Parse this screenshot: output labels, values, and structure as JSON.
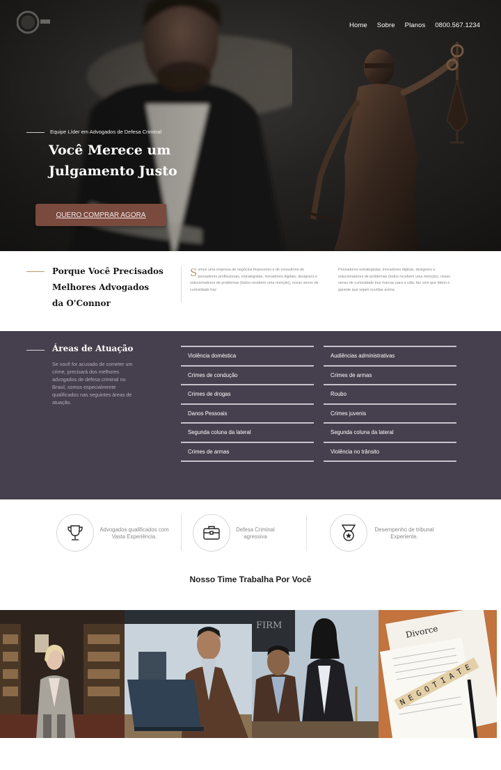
{
  "nav": {
    "items": [
      "Home",
      "Sobre",
      "Planos",
      "0800.567.1234"
    ]
  },
  "hero": {
    "eyebrow": "Equipe Líder em Advogados de Defesa Criminal",
    "title_line1": "Você Merece um",
    "title_line2": "Julgamento Justo",
    "cta": "QUERO COMPRAR AGORA"
  },
  "why": {
    "title_line1": "Porque Você Precisados",
    "title_line2": "Melhores Advogados",
    "title_line3": "da O'Connor",
    "dropcap": "S",
    "paragraph1": "omos uma empresa de negócios financeiros e de consultoria de pensadores profissionais, estrategistas, inovadores digitais, designers e solucionadores de problemas (todos recebem uma menção), nosso senso de curiosidade traz",
    "paragraph2": "Pensadores estrategistas, inovadores digitais, designers e solucionadores de problemas (todos recebem uma menção), nosso senso de curiosidade traz marcas para a vida, faz com que falem e garante que sejam ouvidas acima."
  },
  "areas": {
    "title": "Áreas de Atuação",
    "description": "Se você for acusado de cometer um crime, precisará dos melhores advogados de defesa criminal no Brasil, somos especialmente qualificados nas seguintes áreas de atuação.",
    "left": [
      "Violência doméstica",
      "Crimes de condução",
      "Crimes de drogas",
      "Danos Pessoais",
      "Segunda coluna da lateral",
      "Crimes de armas"
    ],
    "right": [
      "Audiências administrativas",
      "Crimes de armas",
      "Roubo",
      "Crimes juvenis",
      "Segunda coluna da lateral",
      "Violência no trânsito"
    ]
  },
  "features": [
    {
      "line1": "Advogados qualificados com",
      "line2": "Vasta Experiência.",
      "icon": "trophy-icon"
    },
    {
      "line1": "Defesa Criminal",
      "line2": "agressiva",
      "icon": "briefcase-icon"
    },
    {
      "line1": "Desempenho de tribunal",
      "line2": "Experiente.",
      "icon": "medal-icon"
    }
  ],
  "team": {
    "title": "Nosso Time Trabalha Por Você"
  },
  "photos": {
    "firm_sign": "FIRM",
    "divorce_label": "Divorce",
    "tiles": "N E G O T I A T E"
  },
  "colors": {
    "accent_brown": "#7a4a3e",
    "gold_line": "#b59a6a",
    "purple_section": "#463f4d"
  }
}
